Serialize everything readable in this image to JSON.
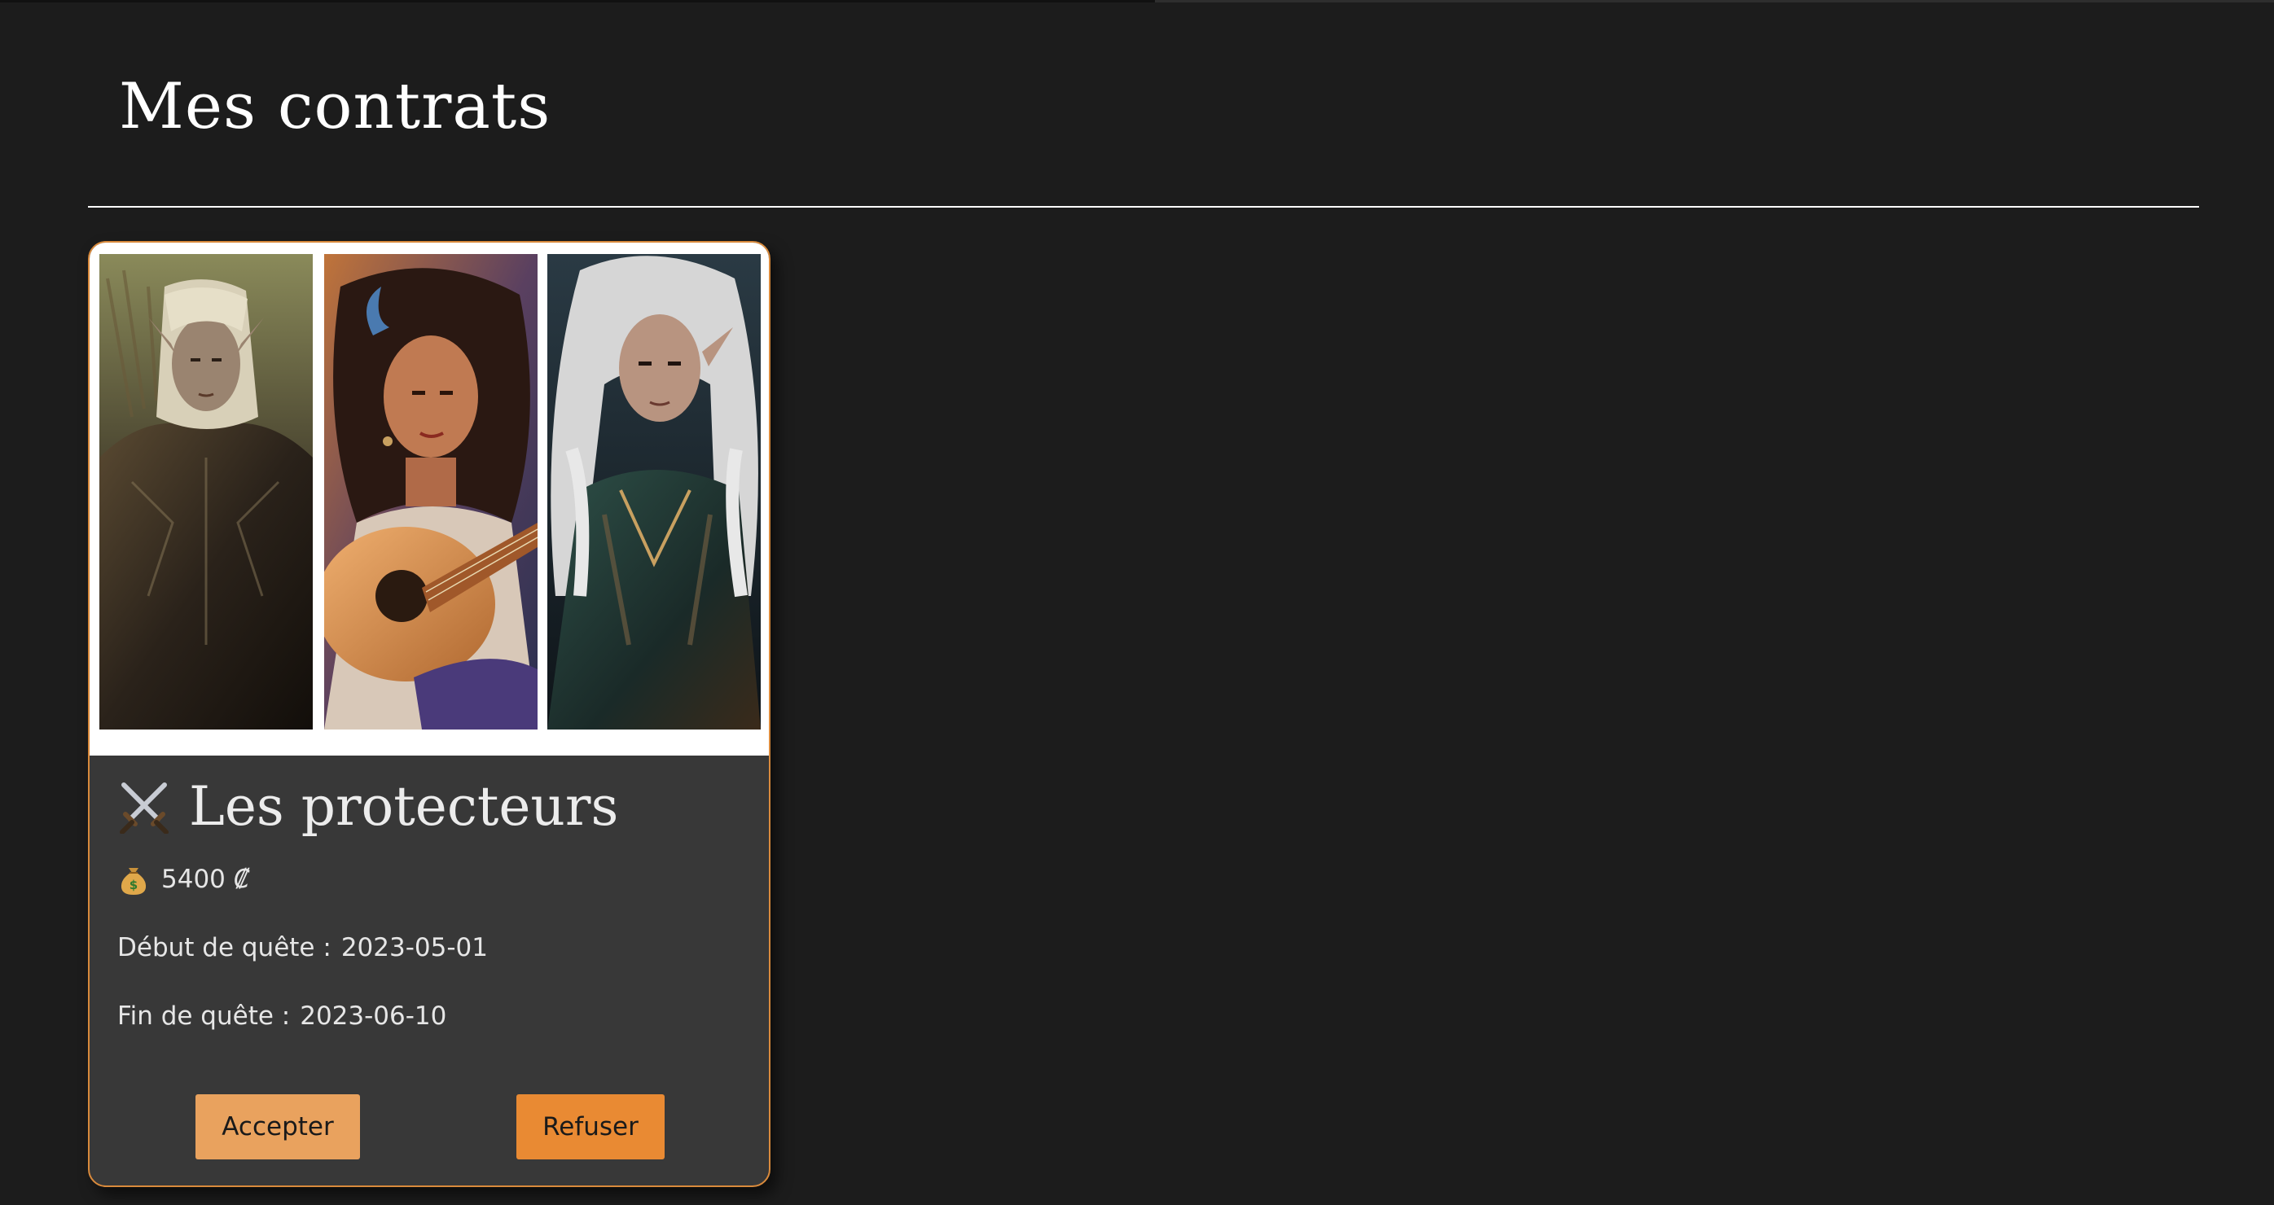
{
  "page": {
    "title": "Mes contrats"
  },
  "contract": {
    "title": "Les protecteurs",
    "title_icon": "crossed-swords-icon",
    "reward_icon": "money-bag-icon",
    "reward_amount": "5400",
    "reward_unit": "₡",
    "start_label": "Début de quête :",
    "start_date": "2023-05-01",
    "end_label": "Fin de quête :",
    "end_date": "2023-06-10",
    "accept_label": "Accepter",
    "refuse_label": "Refuser",
    "portraits": [
      "elf-warrior-portrait",
      "bard-guitar-portrait",
      "elf-ranger-portrait"
    ]
  },
  "colors": {
    "background": "#1c1c1c",
    "card_background": "#383838",
    "card_border": "#d98a3c",
    "accept_button": "#e9a25e",
    "refuse_button": "#e98a33",
    "text": "#e6e6e6"
  }
}
